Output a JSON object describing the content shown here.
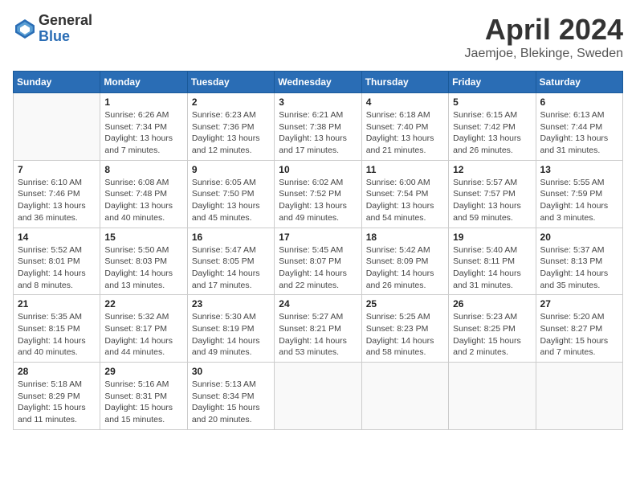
{
  "logo": {
    "general": "General",
    "blue": "Blue"
  },
  "title": {
    "month": "April 2024",
    "location": "Jaemjoe, Blekinge, Sweden"
  },
  "days_of_week": [
    "Sunday",
    "Monday",
    "Tuesday",
    "Wednesday",
    "Thursday",
    "Friday",
    "Saturday"
  ],
  "weeks": [
    [
      {
        "num": "",
        "detail": ""
      },
      {
        "num": "1",
        "detail": "Sunrise: 6:26 AM\nSunset: 7:34 PM\nDaylight: 13 hours\nand 7 minutes."
      },
      {
        "num": "2",
        "detail": "Sunrise: 6:23 AM\nSunset: 7:36 PM\nDaylight: 13 hours\nand 12 minutes."
      },
      {
        "num": "3",
        "detail": "Sunrise: 6:21 AM\nSunset: 7:38 PM\nDaylight: 13 hours\nand 17 minutes."
      },
      {
        "num": "4",
        "detail": "Sunrise: 6:18 AM\nSunset: 7:40 PM\nDaylight: 13 hours\nand 21 minutes."
      },
      {
        "num": "5",
        "detail": "Sunrise: 6:15 AM\nSunset: 7:42 PM\nDaylight: 13 hours\nand 26 minutes."
      },
      {
        "num": "6",
        "detail": "Sunrise: 6:13 AM\nSunset: 7:44 PM\nDaylight: 13 hours\nand 31 minutes."
      }
    ],
    [
      {
        "num": "7",
        "detail": "Sunrise: 6:10 AM\nSunset: 7:46 PM\nDaylight: 13 hours\nand 36 minutes."
      },
      {
        "num": "8",
        "detail": "Sunrise: 6:08 AM\nSunset: 7:48 PM\nDaylight: 13 hours\nand 40 minutes."
      },
      {
        "num": "9",
        "detail": "Sunrise: 6:05 AM\nSunset: 7:50 PM\nDaylight: 13 hours\nand 45 minutes."
      },
      {
        "num": "10",
        "detail": "Sunrise: 6:02 AM\nSunset: 7:52 PM\nDaylight: 13 hours\nand 49 minutes."
      },
      {
        "num": "11",
        "detail": "Sunrise: 6:00 AM\nSunset: 7:54 PM\nDaylight: 13 hours\nand 54 minutes."
      },
      {
        "num": "12",
        "detail": "Sunrise: 5:57 AM\nSunset: 7:57 PM\nDaylight: 13 hours\nand 59 minutes."
      },
      {
        "num": "13",
        "detail": "Sunrise: 5:55 AM\nSunset: 7:59 PM\nDaylight: 14 hours\nand 3 minutes."
      }
    ],
    [
      {
        "num": "14",
        "detail": "Sunrise: 5:52 AM\nSunset: 8:01 PM\nDaylight: 14 hours\nand 8 minutes."
      },
      {
        "num": "15",
        "detail": "Sunrise: 5:50 AM\nSunset: 8:03 PM\nDaylight: 14 hours\nand 13 minutes."
      },
      {
        "num": "16",
        "detail": "Sunrise: 5:47 AM\nSunset: 8:05 PM\nDaylight: 14 hours\nand 17 minutes."
      },
      {
        "num": "17",
        "detail": "Sunrise: 5:45 AM\nSunset: 8:07 PM\nDaylight: 14 hours\nand 22 minutes."
      },
      {
        "num": "18",
        "detail": "Sunrise: 5:42 AM\nSunset: 8:09 PM\nDaylight: 14 hours\nand 26 minutes."
      },
      {
        "num": "19",
        "detail": "Sunrise: 5:40 AM\nSunset: 8:11 PM\nDaylight: 14 hours\nand 31 minutes."
      },
      {
        "num": "20",
        "detail": "Sunrise: 5:37 AM\nSunset: 8:13 PM\nDaylight: 14 hours\nand 35 minutes."
      }
    ],
    [
      {
        "num": "21",
        "detail": "Sunrise: 5:35 AM\nSunset: 8:15 PM\nDaylight: 14 hours\nand 40 minutes."
      },
      {
        "num": "22",
        "detail": "Sunrise: 5:32 AM\nSunset: 8:17 PM\nDaylight: 14 hours\nand 44 minutes."
      },
      {
        "num": "23",
        "detail": "Sunrise: 5:30 AM\nSunset: 8:19 PM\nDaylight: 14 hours\nand 49 minutes."
      },
      {
        "num": "24",
        "detail": "Sunrise: 5:27 AM\nSunset: 8:21 PM\nDaylight: 14 hours\nand 53 minutes."
      },
      {
        "num": "25",
        "detail": "Sunrise: 5:25 AM\nSunset: 8:23 PM\nDaylight: 14 hours\nand 58 minutes."
      },
      {
        "num": "26",
        "detail": "Sunrise: 5:23 AM\nSunset: 8:25 PM\nDaylight: 15 hours\nand 2 minutes."
      },
      {
        "num": "27",
        "detail": "Sunrise: 5:20 AM\nSunset: 8:27 PM\nDaylight: 15 hours\nand 7 minutes."
      }
    ],
    [
      {
        "num": "28",
        "detail": "Sunrise: 5:18 AM\nSunset: 8:29 PM\nDaylight: 15 hours\nand 11 minutes."
      },
      {
        "num": "29",
        "detail": "Sunrise: 5:16 AM\nSunset: 8:31 PM\nDaylight: 15 hours\nand 15 minutes."
      },
      {
        "num": "30",
        "detail": "Sunrise: 5:13 AM\nSunset: 8:34 PM\nDaylight: 15 hours\nand 20 minutes."
      },
      {
        "num": "",
        "detail": ""
      },
      {
        "num": "",
        "detail": ""
      },
      {
        "num": "",
        "detail": ""
      },
      {
        "num": "",
        "detail": ""
      }
    ]
  ]
}
